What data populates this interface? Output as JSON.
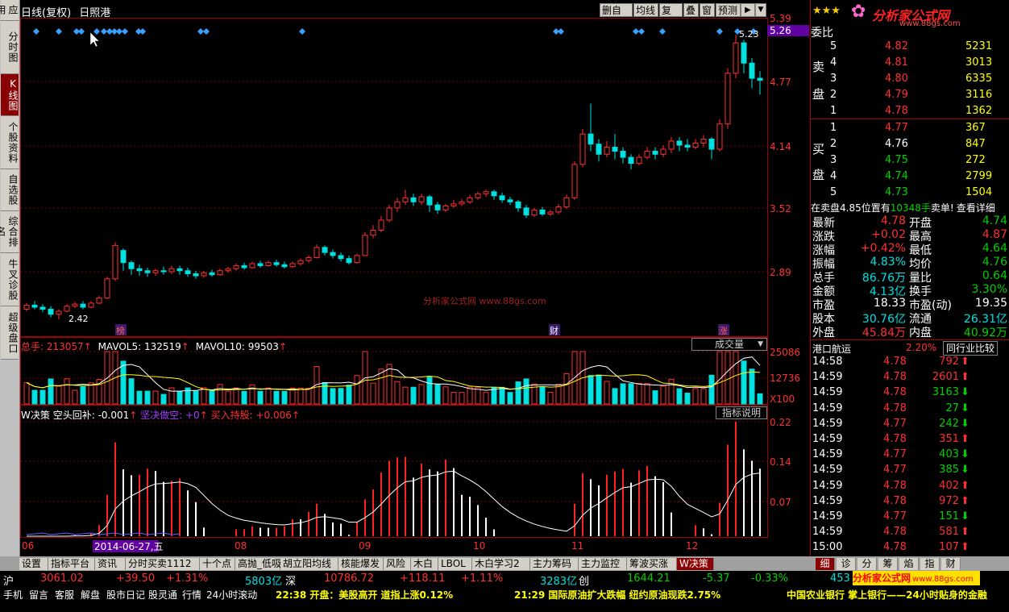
{
  "left_tabs": [
    "应用",
    "分时图",
    "K线图",
    "个股资料",
    "自选股",
    "综合排名",
    "牛叉诊股",
    "超级盘口"
  ],
  "left_tab_active": 2,
  "chart_header": {
    "period": "日线(复权)",
    "stock": "日照港"
  },
  "toolbar": [
    "删自选",
    "均线",
    "复权",
    "叠",
    "窗",
    "预测"
  ],
  "price_axis": [
    "5.39",
    "5.26",
    "4.77",
    "4.14",
    "3.52",
    "2.89"
  ],
  "price_markers": {
    "high": "5.23",
    "low": "2.42"
  },
  "watermark": "分析家公式网 www.88gs.com",
  "badges": {
    "bang": "榜",
    "cai": "财",
    "zhang": "涨"
  },
  "volume_header": {
    "total_label": "总手: ",
    "total": "213057",
    "ma5_label": "MAVOL5: ",
    "ma5": "132519",
    "ma10_label": "MAVOL10: ",
    "ma10": "99503",
    "arrow": "↑"
  },
  "volume_axis": [
    "25086",
    "12736",
    "X100"
  ],
  "volume_dropdown": "成交量",
  "indicator_header": {
    "name": "W决策",
    "a_label": "空头回补: ",
    "a": "-0.001",
    "b_label": "坚决做空: ",
    "b": "+0",
    "c_label": "买入持股: ",
    "c": "+0.006",
    "arrow": "↑"
  },
  "indicator_button": "指标说明",
  "indicator_axis": [
    "0.22",
    "0.14",
    "0.07"
  ],
  "date_axis": [
    "06",
    "2014-06-27,五",
    "08",
    "09",
    "10",
    "11",
    "12"
  ],
  "logo": {
    "brand": "分析家公式网",
    "url": "www.88gs.com"
  },
  "rp_title": "委比",
  "sell_label": [
    "卖",
    "盘"
  ],
  "buy_label": [
    "买",
    "盘"
  ],
  "sell": [
    {
      "n": "5",
      "p": "4.82",
      "v": "5231"
    },
    {
      "n": "4",
      "p": "4.81",
      "v": "3013"
    },
    {
      "n": "3",
      "p": "4.80",
      "v": "6335"
    },
    {
      "n": "2",
      "p": "4.79",
      "v": "3116"
    },
    {
      "n": "1",
      "p": "4.78",
      "v": "1362"
    }
  ],
  "buy": [
    {
      "n": "1",
      "p": "4.77",
      "v": "367"
    },
    {
      "n": "2",
      "p": "4.76",
      "v": "847"
    },
    {
      "n": "3",
      "p": "4.75",
      "v": "272"
    },
    {
      "n": "4",
      "p": "4.74",
      "v": "2799"
    },
    {
      "n": "5",
      "p": "4.73",
      "v": "1504"
    }
  ],
  "notice": {
    "a": "在卖盘4.85位置有",
    "b": "10348手",
    "c": "卖单!",
    "d": "查看详细"
  },
  "quote": [
    {
      "l1": "最新",
      "v1": "4.78",
      "l2": "开盘",
      "v2": "4.74"
    },
    {
      "l1": "涨跌",
      "v1": "+0.02",
      "l2": "最高",
      "v2": "4.87"
    },
    {
      "l1": "涨幅",
      "v1": "+0.42%",
      "l2": "最低",
      "v2": "4.64"
    },
    {
      "l1": "振幅",
      "v1": "4.83%",
      "l2": "均价",
      "v2": "4.76"
    },
    {
      "l1": "总手",
      "v1": "86.76万",
      "l2": "量比",
      "v2": "0.64"
    },
    {
      "l1": "金额",
      "v1": "4.13亿",
      "l2": "换手",
      "v2": "3.30%"
    },
    {
      "l1": "市盈",
      "v1": "18.33",
      "l2": "市盈(动)",
      "v2": "19.35"
    },
    {
      "l1": "股本",
      "v1": "30.76亿",
      "l2": "流通",
      "v2": "26.31亿"
    },
    {
      "l1": "外盘",
      "v1": "45.84万",
      "l2": "内盘",
      "v2": "40.92万"
    }
  ],
  "sector": {
    "name": "港口航运",
    "pct": "2.20%",
    "btn": "同行业比较"
  },
  "ticks": [
    {
      "t": "14:58",
      "p": "4.78",
      "v": "792",
      "d": "up"
    },
    {
      "t": "14:59",
      "p": "4.78",
      "v": "2601",
      "d": "up"
    },
    {
      "t": "14:59",
      "p": "4.78",
      "v": "3163",
      "d": "down"
    },
    {
      "t": "14:59",
      "p": "4.78",
      "v": "27",
      "d": "down"
    },
    {
      "t": "14:59",
      "p": "4.77",
      "v": "242",
      "d": "down"
    },
    {
      "t": "14:59",
      "p": "4.78",
      "v": "351",
      "d": "up"
    },
    {
      "t": "14:59",
      "p": "4.77",
      "v": "403",
      "d": "down"
    },
    {
      "t": "14:59",
      "p": "4.77",
      "v": "385",
      "d": "down"
    },
    {
      "t": "14:59",
      "p": "4.78",
      "v": "402",
      "d": "up"
    },
    {
      "t": "14:59",
      "p": "4.78",
      "v": "972",
      "d": "up"
    },
    {
      "t": "14:59",
      "p": "4.77",
      "v": "151",
      "d": "down"
    },
    {
      "t": "14:59",
      "p": "4.78",
      "v": "581",
      "d": "up"
    },
    {
      "t": "15:00",
      "p": "4.78",
      "v": "107",
      "d": "up"
    }
  ],
  "bottom_tabs": [
    "设置",
    "指标平台",
    "资讯",
    "分时买卖1112",
    "十个点",
    "高抛_低吸",
    "胡立阳均线",
    "核能爆发",
    "风险",
    "木白",
    "LBOL",
    "木白学习2",
    "主力筹码",
    "主力监控",
    "筹波买涨",
    "W决策"
  ],
  "bottom_tab_active": 15,
  "right_bottom_tabs": [
    "细",
    "诊",
    "分",
    "筹",
    "焰",
    "指",
    "财"
  ],
  "status": {
    "sh_label": "沪",
    "sh": "3061.02",
    "sh_chg": "+39.50",
    "sh_pct": "+1.31%",
    "sh_amt": "5803亿",
    "sz_label": "深",
    "sz": "10786.72",
    "sz_chg": "+118.11",
    "sz_pct": "+1.11%",
    "sz_amt": "3283亿",
    "cy_label": "创",
    "cy": "1644.21",
    "cy_chg": "-5.37",
    "cy_pct": "-0.33%",
    "extra": "453"
  },
  "bottom_links": [
    "手机",
    "留言",
    "客服",
    "解盘",
    "股市日记",
    "股灵通",
    "行情",
    "24小时滚动"
  ],
  "news": [
    "22:38 开盘：美股高开 道指上涨0.12%",
    "21:29 国际原油扩大跌幅 纽约原油现跌2.75%",
    "中国农业银行 掌上银行——24小时贴身的金融"
  ],
  "candles": [
    [
      2.52,
      2.56,
      2.58,
      2.5
    ],
    [
      2.56,
      2.54,
      2.6,
      2.52
    ],
    [
      2.54,
      2.52,
      2.57,
      2.49
    ],
    [
      2.52,
      2.47,
      2.55,
      2.44
    ],
    [
      2.47,
      2.5,
      2.52,
      2.42
    ],
    [
      2.5,
      2.55,
      2.57,
      2.49
    ],
    [
      2.55,
      2.57,
      2.59,
      2.53
    ],
    [
      2.57,
      2.54,
      2.6,
      2.52
    ],
    [
      2.54,
      2.58,
      2.6,
      2.53
    ],
    [
      2.58,
      2.63,
      2.65,
      2.57
    ],
    [
      2.63,
      2.82,
      2.84,
      2.62
    ],
    [
      2.82,
      3.15,
      3.18,
      2.8
    ],
    [
      3.1,
      2.98,
      3.12,
      2.9
    ],
    [
      2.98,
      2.92,
      3.0,
      2.86
    ],
    [
      2.92,
      2.9,
      2.96,
      2.85
    ],
    [
      2.9,
      2.88,
      2.93,
      2.84
    ],
    [
      2.88,
      2.9,
      2.92,
      2.85
    ],
    [
      2.9,
      2.89,
      2.94,
      2.86
    ],
    [
      2.89,
      2.92,
      2.95,
      2.87
    ],
    [
      2.92,
      2.9,
      2.95,
      2.86
    ],
    [
      2.9,
      2.87,
      2.93,
      2.84
    ],
    [
      2.87,
      2.85,
      2.9,
      2.82
    ],
    [
      2.85,
      2.88,
      2.9,
      2.83
    ],
    [
      2.88,
      2.86,
      2.91,
      2.84
    ],
    [
      2.86,
      2.9,
      2.92,
      2.85
    ],
    [
      2.9,
      2.92,
      2.94,
      2.88
    ],
    [
      2.92,
      2.95,
      2.97,
      2.9
    ],
    [
      2.95,
      2.93,
      2.98,
      2.91
    ],
    [
      2.93,
      2.97,
      2.99,
      2.92
    ],
    [
      2.97,
      2.95,
      3.0,
      2.93
    ],
    [
      2.95,
      2.98,
      3.0,
      2.94
    ],
    [
      2.98,
      2.96,
      3.01,
      2.94
    ],
    [
      2.96,
      2.94,
      2.99,
      2.92
    ],
    [
      2.94,
      2.97,
      2.99,
      2.93
    ],
    [
      2.97,
      3.0,
      3.02,
      2.95
    ],
    [
      3.0,
      3.03,
      3.05,
      2.98
    ],
    [
      3.03,
      3.13,
      3.16,
      3.02
    ],
    [
      3.13,
      3.08,
      3.15,
      3.05
    ],
    [
      3.08,
      3.05,
      3.11,
      3.02
    ],
    [
      3.05,
      3.02,
      3.08,
      2.99
    ],
    [
      3.02,
      2.98,
      3.05,
      2.96
    ],
    [
      2.98,
      3.05,
      3.07,
      2.97
    ],
    [
      3.05,
      3.25,
      3.28,
      3.04
    ],
    [
      3.25,
      3.3,
      3.35,
      3.22
    ],
    [
      3.3,
      3.4,
      3.44,
      3.28
    ],
    [
      3.4,
      3.52,
      3.55,
      3.38
    ],
    [
      3.52,
      3.58,
      3.62,
      3.48
    ],
    [
      3.58,
      3.62,
      3.7,
      3.55
    ],
    [
      3.62,
      3.58,
      3.66,
      3.54
    ],
    [
      3.58,
      3.63,
      3.66,
      3.55
    ],
    [
      3.63,
      3.55,
      3.65,
      3.48
    ],
    [
      3.55,
      3.5,
      3.58,
      3.46
    ],
    [
      3.5,
      3.54,
      3.56,
      3.48
    ],
    [
      3.54,
      3.56,
      3.6,
      3.52
    ],
    [
      3.56,
      3.58,
      3.61,
      3.54
    ],
    [
      3.58,
      3.62,
      3.65,
      3.56
    ],
    [
      3.62,
      3.66,
      3.68,
      3.6
    ],
    [
      3.66,
      3.68,
      3.7,
      3.63
    ],
    [
      3.68,
      3.64,
      3.7,
      3.6
    ],
    [
      3.64,
      3.6,
      3.67,
      3.57
    ],
    [
      3.6,
      3.58,
      3.63,
      3.55
    ],
    [
      3.58,
      3.52,
      3.6,
      3.48
    ],
    [
      3.52,
      3.45,
      3.55,
      3.42
    ],
    [
      3.45,
      3.5,
      3.52,
      3.43
    ],
    [
      3.5,
      3.46,
      3.53,
      3.44
    ],
    [
      3.46,
      3.48,
      3.5,
      3.44
    ],
    [
      3.48,
      3.53,
      3.56,
      3.46
    ],
    [
      3.53,
      3.62,
      3.65,
      3.51
    ],
    [
      3.62,
      3.95,
      3.98,
      3.6
    ],
    [
      3.95,
      4.25,
      4.3,
      3.92
    ],
    [
      4.25,
      4.15,
      4.55,
      4.08
    ],
    [
      4.15,
      4.05,
      4.2,
      3.98
    ],
    [
      4.05,
      4.12,
      4.18,
      4.02
    ],
    [
      4.12,
      4.08,
      4.25,
      4.0
    ],
    [
      4.08,
      4.02,
      4.12,
      3.96
    ],
    [
      4.02,
      3.96,
      4.05,
      3.9
    ],
    [
      3.96,
      4.02,
      4.05,
      3.94
    ],
    [
      4.02,
      4.08,
      4.12,
      4.0
    ],
    [
      4.08,
      4.05,
      4.12,
      4.0
    ],
    [
      4.05,
      4.1,
      4.14,
      4.02
    ],
    [
      4.1,
      4.18,
      4.22,
      4.06
    ],
    [
      4.18,
      4.14,
      4.22,
      4.08
    ],
    [
      4.14,
      4.12,
      4.2,
      4.08
    ],
    [
      4.12,
      4.16,
      4.2,
      4.1
    ],
    [
      4.16,
      4.2,
      4.24,
      4.12
    ],
    [
      4.2,
      4.1,
      4.22,
      4.0
    ],
    [
      4.1,
      4.35,
      4.4,
      4.08
    ],
    [
      4.35,
      4.85,
      4.9,
      4.3
    ],
    [
      4.85,
      5.15,
      5.23,
      4.8
    ],
    [
      5.15,
      4.95,
      5.18,
      4.85
    ],
    [
      4.95,
      4.8,
      5.0,
      4.7
    ],
    [
      4.8,
      4.78,
      4.87,
      4.64
    ]
  ]
}
